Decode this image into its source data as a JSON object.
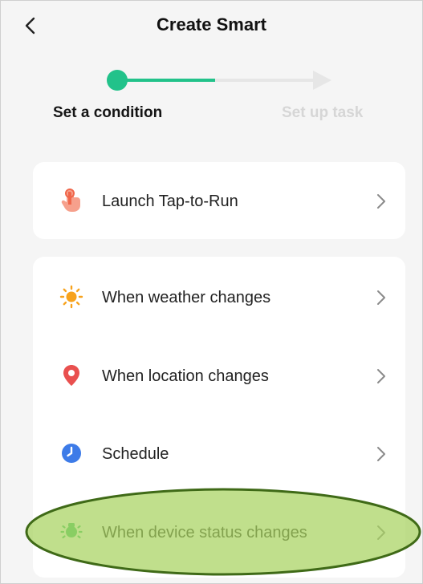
{
  "header": {
    "title": "Create Smart",
    "back_icon": "chevron-left-icon"
  },
  "stepper": {
    "progress": 0.5,
    "active_color": "#22c28a",
    "inactive_color": "#e6e6e6",
    "steps": [
      {
        "label": "Set a condition",
        "state": "active"
      },
      {
        "label": "Set up task",
        "state": "inactive"
      }
    ]
  },
  "cards": [
    {
      "items": [
        {
          "label": "Launch Tap-to-Run",
          "icon": "tap-hand-icon",
          "icon_color": "#f0664a"
        }
      ]
    },
    {
      "items": [
        {
          "label": "When weather changes",
          "icon": "sun-icon",
          "icon_color": "#f7a21c"
        },
        {
          "label": "When location changes",
          "icon": "location-pin-icon",
          "icon_color": "#e9504f"
        },
        {
          "label": "Schedule",
          "icon": "clock-icon",
          "icon_color": "#3d7be8"
        },
        {
          "label": "When device status changes",
          "icon": "device-status-icon",
          "icon_color": "#3cc36c"
        }
      ]
    }
  ],
  "highlight": {
    "target": "When device status changes",
    "fill": "#a8d260",
    "stroke": "#3f6a17"
  }
}
